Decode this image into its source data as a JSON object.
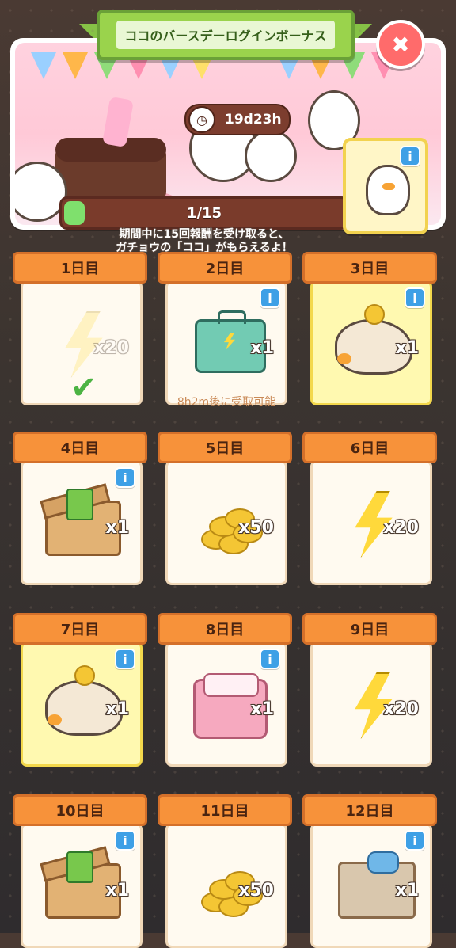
{
  "title": "ココのバースデーログインボーナス",
  "timer": "19d23h",
  "progress": {
    "text": "1/15",
    "value": 1,
    "max": 15
  },
  "description_line1": "期間中に15回報酬を受け取ると、",
  "description_line2": "ガチョウの「ココ」がもらえるよ！",
  "close_symbol": "✖",
  "info_symbol": "i",
  "check_symbol": "✔",
  "days": [
    {
      "label": "1日目",
      "quantity": "x20",
      "icon": "energy-bolt-icon",
      "claimed": true,
      "highlight": false,
      "info": false
    },
    {
      "label": "2日目",
      "quantity": "x1",
      "icon": "energy-toolbox-icon",
      "claimed": false,
      "highlight": false,
      "info": true,
      "status": "8h2m後に受取可能"
    },
    {
      "label": "3日目",
      "quantity": "x1",
      "icon": "coin-bag-icon",
      "claimed": false,
      "highlight": true,
      "info": true
    },
    {
      "label": "4日目",
      "quantity": "x1",
      "icon": "tool-crate-icon",
      "claimed": false,
      "highlight": false,
      "info": true
    },
    {
      "label": "5日目",
      "quantity": "x50",
      "icon": "coins-icon",
      "claimed": false,
      "highlight": false,
      "info": false
    },
    {
      "label": "6日目",
      "quantity": "x20",
      "icon": "energy-bolt-icon",
      "claimed": false,
      "highlight": false,
      "info": false
    },
    {
      "label": "7日目",
      "quantity": "x1",
      "icon": "coin-bag-icon",
      "claimed": false,
      "highlight": true,
      "info": true
    },
    {
      "label": "8日目",
      "quantity": "x1",
      "icon": "pink-gift-box-icon",
      "claimed": false,
      "highlight": false,
      "info": true
    },
    {
      "label": "9日目",
      "quantity": "x20",
      "icon": "energy-bolt-icon",
      "claimed": false,
      "highlight": false,
      "info": false
    },
    {
      "label": "10日目",
      "quantity": "x1",
      "icon": "tool-crate-icon",
      "claimed": false,
      "highlight": false,
      "info": true
    },
    {
      "label": "11日目",
      "quantity": "x50",
      "icon": "coins-icon",
      "claimed": false,
      "highlight": false,
      "info": false
    },
    {
      "label": "12日目",
      "quantity": "x1",
      "icon": "parts-box-icon",
      "claimed": false,
      "highlight": false,
      "info": true
    }
  ],
  "colors": {
    "ribbon_green": "#9ad34c",
    "day_orange": "#f7923a",
    "highlight_yellow": "#fff9b0",
    "close_red": "#ff6b6b",
    "info_blue": "#3ea0e6"
  }
}
